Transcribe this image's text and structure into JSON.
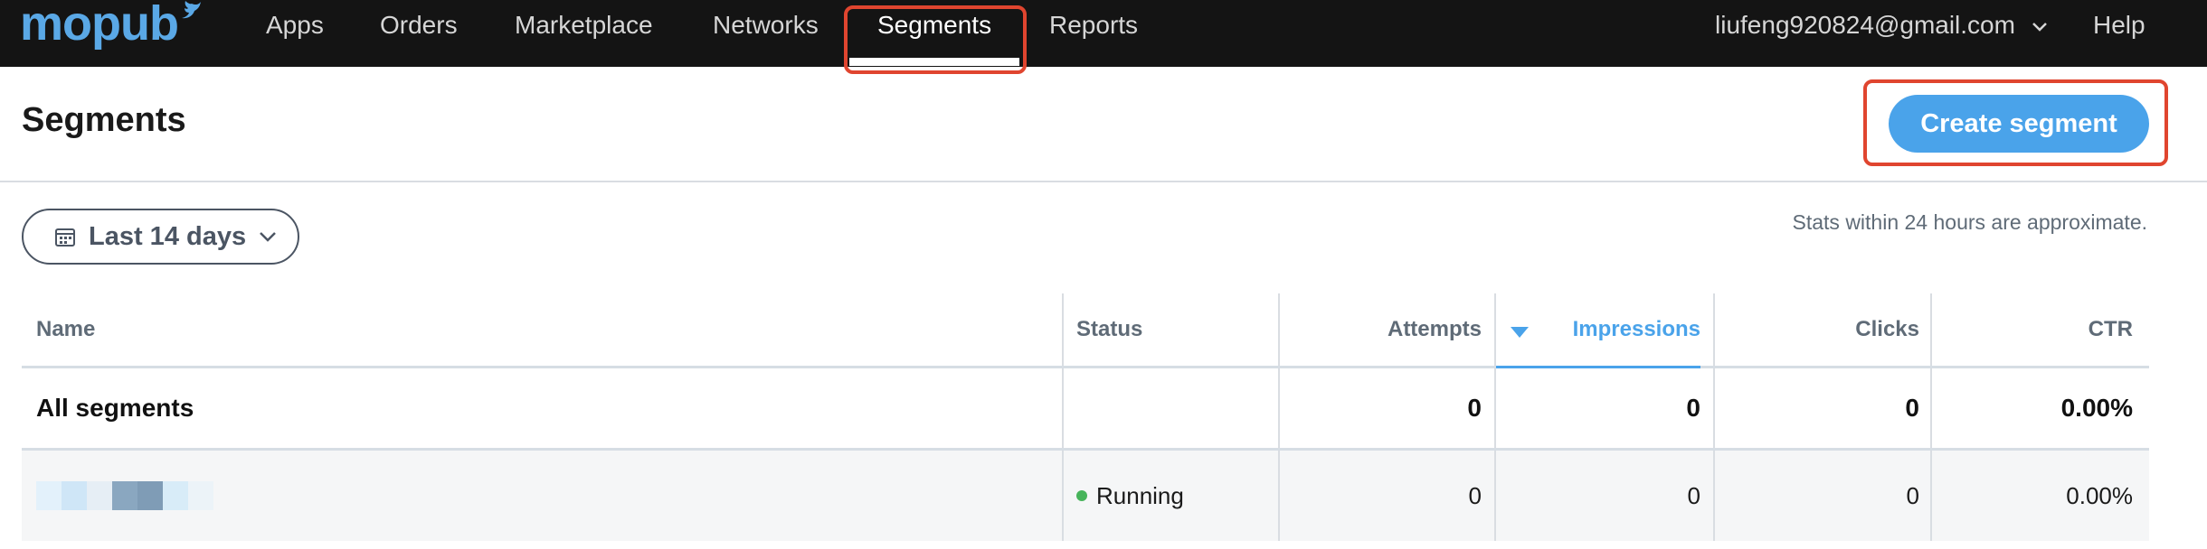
{
  "nav": {
    "logo_text": "mopub",
    "items": [
      "Apps",
      "Orders",
      "Marketplace",
      "Networks",
      "Segments",
      "Reports"
    ],
    "active": "Segments",
    "account_email": "liufeng920824@gmail.com",
    "help_label": "Help"
  },
  "page": {
    "title": "Segments",
    "create_button": "Create segment"
  },
  "filter": {
    "date_range": "Last 14 days",
    "stats_note": "Stats within 24 hours are approximate."
  },
  "table": {
    "headers": [
      "Name",
      "Status",
      "Attempts",
      "Impressions",
      "Clicks",
      "CTR"
    ],
    "sorted_column": "Impressions",
    "total_row": {
      "name": "All segments",
      "status": "",
      "attempts": "0",
      "impressions": "0",
      "clicks": "0",
      "ctr": "0.00%"
    },
    "rows": [
      {
        "name": "",
        "status": "Running",
        "attempts": "0",
        "impressions": "0",
        "clicks": "0",
        "ctr": "0.00%"
      }
    ]
  },
  "colors": {
    "nav_bg": "#141414",
    "accent": "#4aa3ea",
    "highlight": "#e0452f",
    "running": "#47b45b"
  }
}
